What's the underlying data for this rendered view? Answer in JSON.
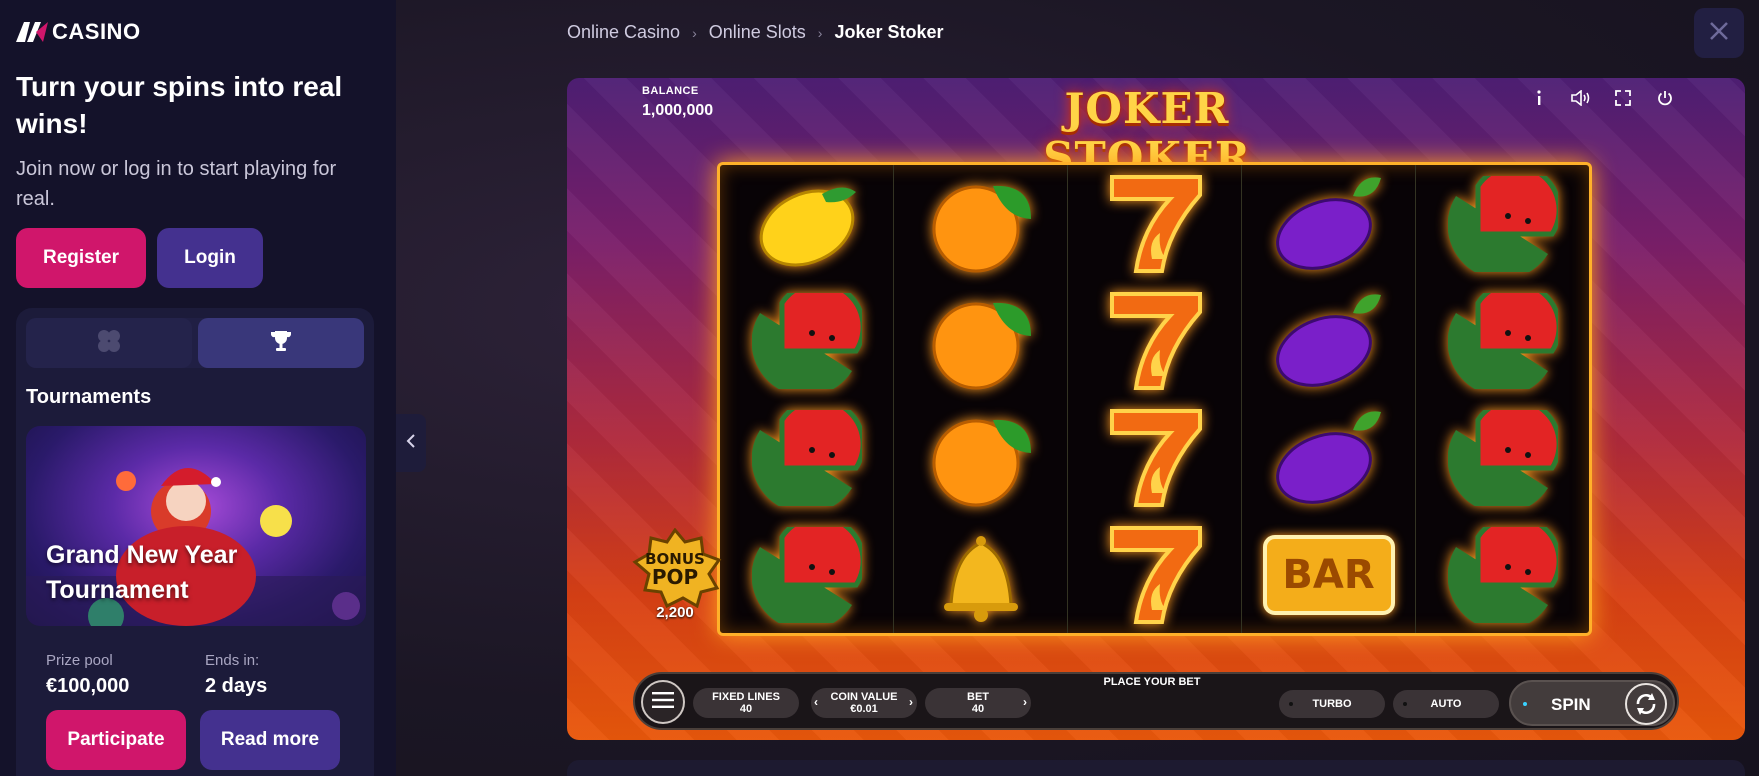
{
  "sidebar": {
    "logo_text": "CASINO",
    "promo_title": "Turn your spins into real wins!",
    "promo_subtitle": "Join now or log in to start playing for real.",
    "register_label": "Register",
    "login_label": "Login",
    "tabs": [
      {
        "icon": "clover-icon",
        "active": false
      },
      {
        "icon": "trophy-icon",
        "active": true
      }
    ],
    "section_heading": "Tournaments",
    "tournament": {
      "title": "Grand New Year Tournament",
      "prize_label": "Prize pool",
      "prize_value": "€100,000",
      "ends_label": "Ends in:",
      "ends_value": "2 days",
      "participate_label": "Participate",
      "read_more_label": "Read more"
    }
  },
  "breadcrumb": [
    "Online Casino",
    "Online Slots",
    "Joker Stoker"
  ],
  "game": {
    "logo": "JOKER STOKER",
    "balance_label": "BALANCE",
    "balance_value": "1,000,000",
    "icons": [
      "info-icon",
      "sound-icon",
      "fullscreen-icon",
      "power-icon"
    ],
    "reels": [
      [
        "lemon",
        "watermelon",
        "watermelon",
        "watermelon"
      ],
      [
        "orange",
        "orange",
        "orange",
        "bell"
      ],
      [
        "seven",
        "seven",
        "seven",
        "seven"
      ],
      [
        "plum",
        "plum",
        "plum",
        "bar"
      ],
      [
        "watermelon",
        "watermelon",
        "watermelon",
        "watermelon"
      ]
    ],
    "bonus_pop": {
      "line1": "BONUS",
      "line2": "POP",
      "value": "2,200"
    },
    "place_bet": "PLACE YOUR BET",
    "fixed_lines": {
      "label": "FIXED LINES",
      "value": "40"
    },
    "coin_value": {
      "label": "COIN VALUE",
      "value": "€0.01"
    },
    "bet": {
      "label": "BET",
      "value": "40"
    },
    "turbo_label": "TURBO",
    "auto_label": "AUTO",
    "spin_label": "SPIN",
    "bar_text": "BAR"
  },
  "colors": {
    "accent_pink": "#d0166b",
    "accent_purple": "#44318f",
    "reel_border": "#ffb12a"
  }
}
